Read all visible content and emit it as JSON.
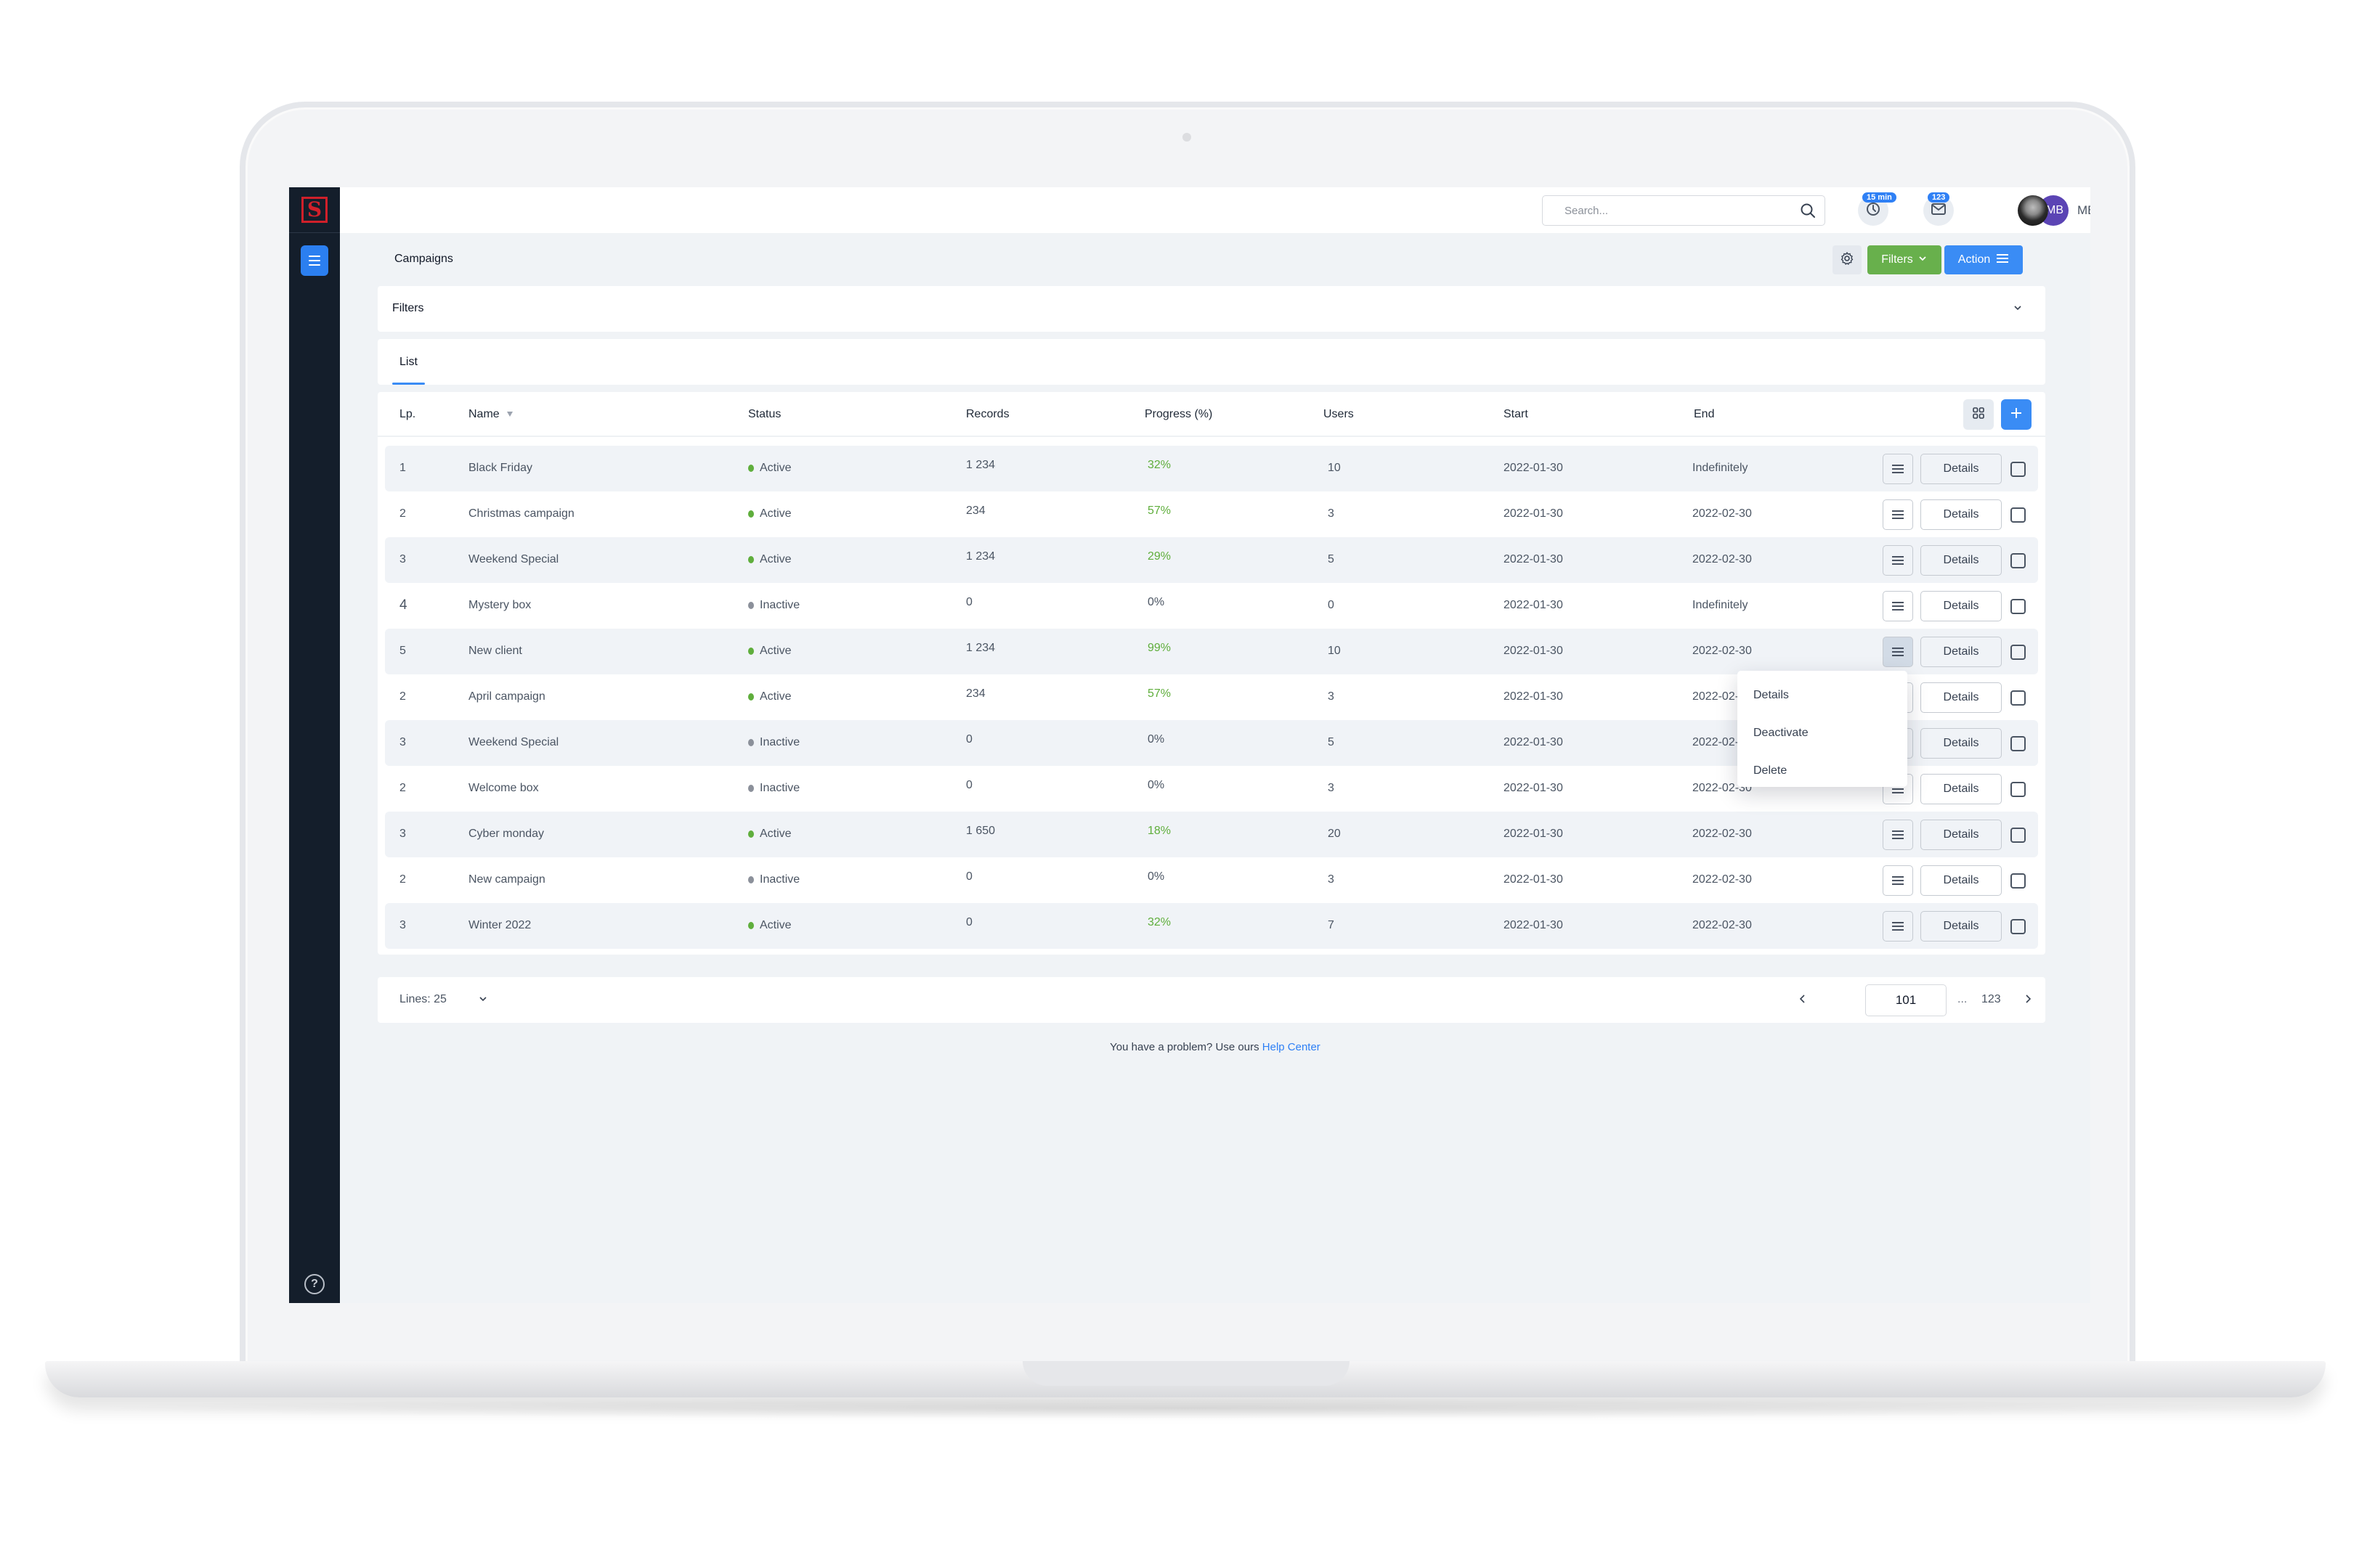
{
  "topbar": {
    "search_placeholder": "Search...",
    "timer_badge": "15 min",
    "mail_badge": "123",
    "user_initials": "MB",
    "user_name": "MB"
  },
  "page": {
    "title": "Campaigns",
    "filters_button": "Filters",
    "action_button": "Action"
  },
  "filters_panel": {
    "label": "Filters"
  },
  "tabs": [
    {
      "label": "List",
      "active": true
    }
  ],
  "table": {
    "columns": [
      "Lp.",
      "Name",
      "Status",
      "Records",
      "Progress (%)",
      "Users",
      "Start",
      "End"
    ],
    "details_label": "Details",
    "rows": [
      {
        "lp": "1",
        "name": "Black Friday",
        "status": "Active",
        "records": "1 234",
        "progress": "32%",
        "users": "10",
        "start": "2022-01-30",
        "end": "Indefinitely"
      },
      {
        "lp": "2",
        "name": "Christmas campaign",
        "status": "Active",
        "records": "234",
        "progress": "57%",
        "users": "3",
        "start": "2022-01-30",
        "end": "2022-02-30"
      },
      {
        "lp": "3",
        "name": "Weekend Special",
        "status": "Active",
        "records": "1 234",
        "progress": "29%",
        "users": "5",
        "start": "2022-01-30",
        "end": "2022-02-30"
      },
      {
        "lp": "4",
        "name": "Mystery box",
        "status": "Inactive",
        "records": "0",
        "progress": "0%",
        "users": "0",
        "start": "2022-01-30",
        "end": "Indefinitely"
      },
      {
        "lp": "5",
        "name": "New client",
        "status": "Active",
        "records": "1 234",
        "progress": "99%",
        "users": "10",
        "start": "2022-01-30",
        "end": "2022-02-30"
      },
      {
        "lp": "2",
        "name": "April campaign",
        "status": "Active",
        "records": "234",
        "progress": "57%",
        "users": "3",
        "start": "2022-01-30",
        "end": "2022-02-30"
      },
      {
        "lp": "3",
        "name": "Weekend Special",
        "status": "Inactive",
        "records": "0",
        "progress": "0%",
        "users": "5",
        "start": "2022-01-30",
        "end": "2022-02-30"
      },
      {
        "lp": "2",
        "name": "Welcome box",
        "status": "Inactive",
        "records": "0",
        "progress": "0%",
        "users": "3",
        "start": "2022-01-30",
        "end": "2022-02-30"
      },
      {
        "lp": "3",
        "name": "Cyber monday",
        "status": "Active",
        "records": "1 650",
        "progress": "18%",
        "users": "20",
        "start": "2022-01-30",
        "end": "2022-02-30"
      },
      {
        "lp": "2",
        "name": "New campaign",
        "status": "Inactive",
        "records": "0",
        "progress": "0%",
        "users": "3",
        "start": "2022-01-30",
        "end": "2022-02-30"
      },
      {
        "lp": "3",
        "name": "Winter 2022",
        "status": "Active",
        "records": "0",
        "progress": "32%",
        "users": "7",
        "start": "2022-01-30",
        "end": "2022-02-30"
      }
    ]
  },
  "row_menu": {
    "open_for_row": 5,
    "items": [
      "Details",
      "Deactivate",
      "Delete"
    ]
  },
  "pagination": {
    "lines_label": "Lines: 25",
    "current_page": "101",
    "ellipsis": "...",
    "last_page": "123"
  },
  "footer": {
    "text": "You have a problem? Use ours",
    "link": "Help Center"
  },
  "colors": {
    "primary": "#3a8cf5",
    "success": "#68b04c",
    "active_dot": "#5fae3c",
    "inactive_dot": "#8b909a",
    "progress_positive": "#5fae3c",
    "sidebar": "#141e2b",
    "brand_red": "#d0202a",
    "avatar_purple": "#5b44b4"
  }
}
